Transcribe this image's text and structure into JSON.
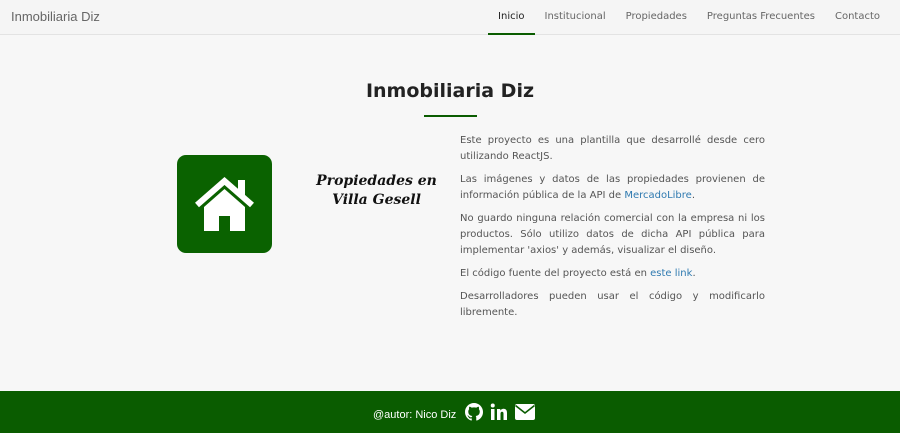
{
  "navbar": {
    "brand": "Inmobiliaria Diz",
    "items": [
      {
        "label": "Inicio",
        "active": true
      },
      {
        "label": "Institucional"
      },
      {
        "label": "Propiedades"
      },
      {
        "label": "Preguntas Frecuentes"
      },
      {
        "label": "Contacto"
      }
    ]
  },
  "main": {
    "title": "Inmobiliaria Diz",
    "logo_icon": "house-icon",
    "slogan_line1": "Propiedades en",
    "slogan_line2": "Villa Gesell",
    "p1": "Este proyecto es una plantilla que desarrollé desde cero utilizando ReactJS.",
    "p2_before": "Las imágenes y datos de las propiedades provienen de información pública de la API de ",
    "p2_link": "MercadoLibre",
    "p2_after": ".",
    "p3": "No guardo ninguna relación comercial con la empresa ni los productos. Sólo utilizo datos de dicha API pública para implementar 'axios' y además, visualizar el diseño.",
    "p4_before": "El código fuente del proyecto está en ",
    "p4_link": "este link",
    "p4_after": ".",
    "p5": "Desarrolladores pueden usar el código y modificarlo libremente."
  },
  "footer": {
    "author": "@autor: Nico Diz",
    "icons": [
      "github-icon",
      "linkedin-icon",
      "envelope-icon"
    ]
  },
  "colors": {
    "brand_green": "#0a5c00",
    "link_blue": "#2f7ab0"
  }
}
